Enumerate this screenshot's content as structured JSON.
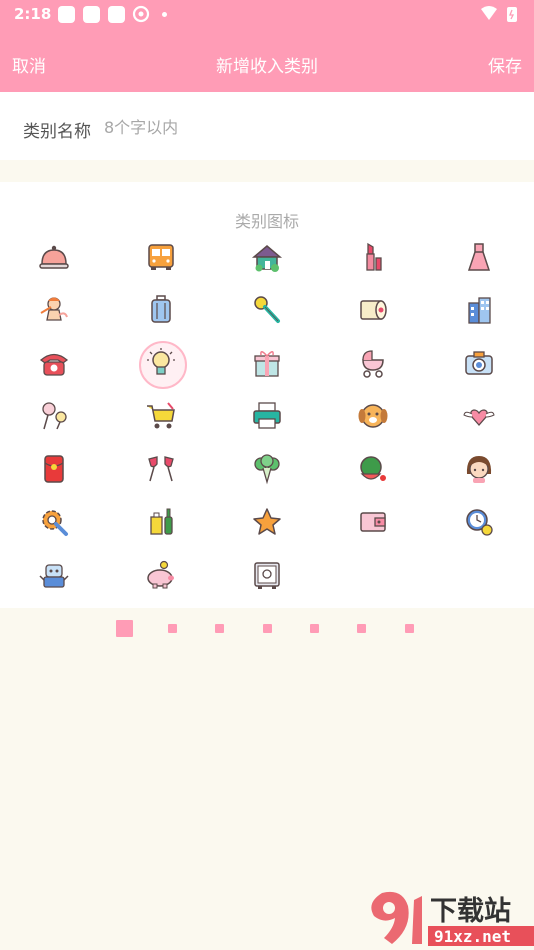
{
  "status": {
    "time": "2:18"
  },
  "nav": {
    "cancel": "取消",
    "title": "新增收入类别",
    "save": "保存"
  },
  "form": {
    "name_label": "类别名称",
    "name_placeholder": "8个字以内",
    "name_value": ""
  },
  "icons": {
    "title": "类别图标",
    "selected": "lightbulb",
    "items": [
      "cloche",
      "bus",
      "house",
      "lipstick",
      "dress",
      "cupid",
      "suitcase",
      "microphone",
      "tape",
      "building",
      "telephone",
      "lightbulb",
      "gift",
      "stroller",
      "camera",
      "candy",
      "shopping-cart",
      "printer",
      "dog",
      "winged-heart",
      "red-envelope",
      "wine-glasses",
      "vegetable",
      "watermelon",
      "girl",
      "gear-wrench",
      "drinks",
      "star",
      "wallet",
      "clock-coin",
      "robot",
      "piggy-bank",
      "safe"
    ]
  },
  "pagination": {
    "pages": 7,
    "current": 1
  },
  "watermark": {
    "brand": "下载站",
    "url": "91xz.net",
    "mark": "9"
  },
  "colors": {
    "accent": "#ff9cb6",
    "background": "#fbf9ef"
  }
}
